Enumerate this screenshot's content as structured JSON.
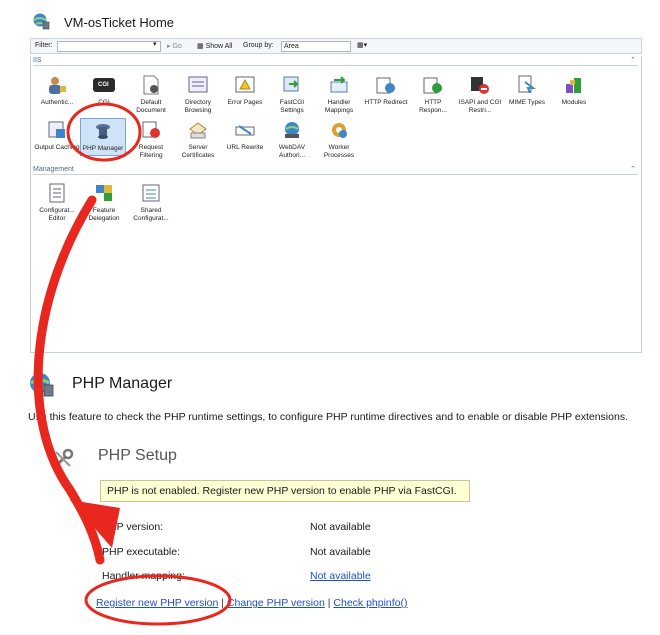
{
  "iis": {
    "window_title": "VM-osTicket Home",
    "filter": {
      "label": "Filter:",
      "go_label": "Go",
      "show_all_label": "Show All",
      "group_by_label": "Group by:",
      "group_by_value": "Area"
    },
    "section_iis": "IIS",
    "section_management": "Management",
    "icons_row1": [
      "Authentic...",
      "CGI",
      "Default Document",
      "Directory Browsing",
      "Error Pages",
      "FastCGI Settings",
      "Handler Mappings",
      "HTTP Redirect",
      "HTTP Respon...",
      "ISAPI and CGI Restri...",
      "MIME Types",
      "Modules"
    ],
    "icons_row2": [
      "Output Caching",
      "PHP Manager",
      "Request Filtering",
      "Server Certificates",
      "URL Rewrite",
      "WebDAV Authori...",
      "Worker Processes"
    ],
    "icons_mgmt": [
      "Configurat... Editor",
      "Feature Delegation",
      "Shared Configurat..."
    ],
    "cgi_badge": "CGI"
  },
  "php": {
    "title": "PHP Manager",
    "description": "Use this feature to check the PHP runtime settings, to configure PHP runtime directives and to enable or disable PHP extensions.",
    "setup_title": "PHP Setup",
    "warning": "PHP is not enabled. Register new PHP version to enable PHP via FastCGI.",
    "rows": [
      {
        "label": "PHP version:",
        "value": "Not available"
      },
      {
        "label": "PHP executable:",
        "value": "Not available"
      },
      {
        "label": "Handler mapping:",
        "value": "Not available"
      }
    ],
    "links": {
      "register": "Register new PHP version",
      "change": "Change PHP version",
      "check": "Check phpinfo()"
    }
  },
  "colors": {
    "annotation_red": "#e8281e",
    "link_blue": "#1f4fc9",
    "warning_bg": "#ffffd6"
  }
}
